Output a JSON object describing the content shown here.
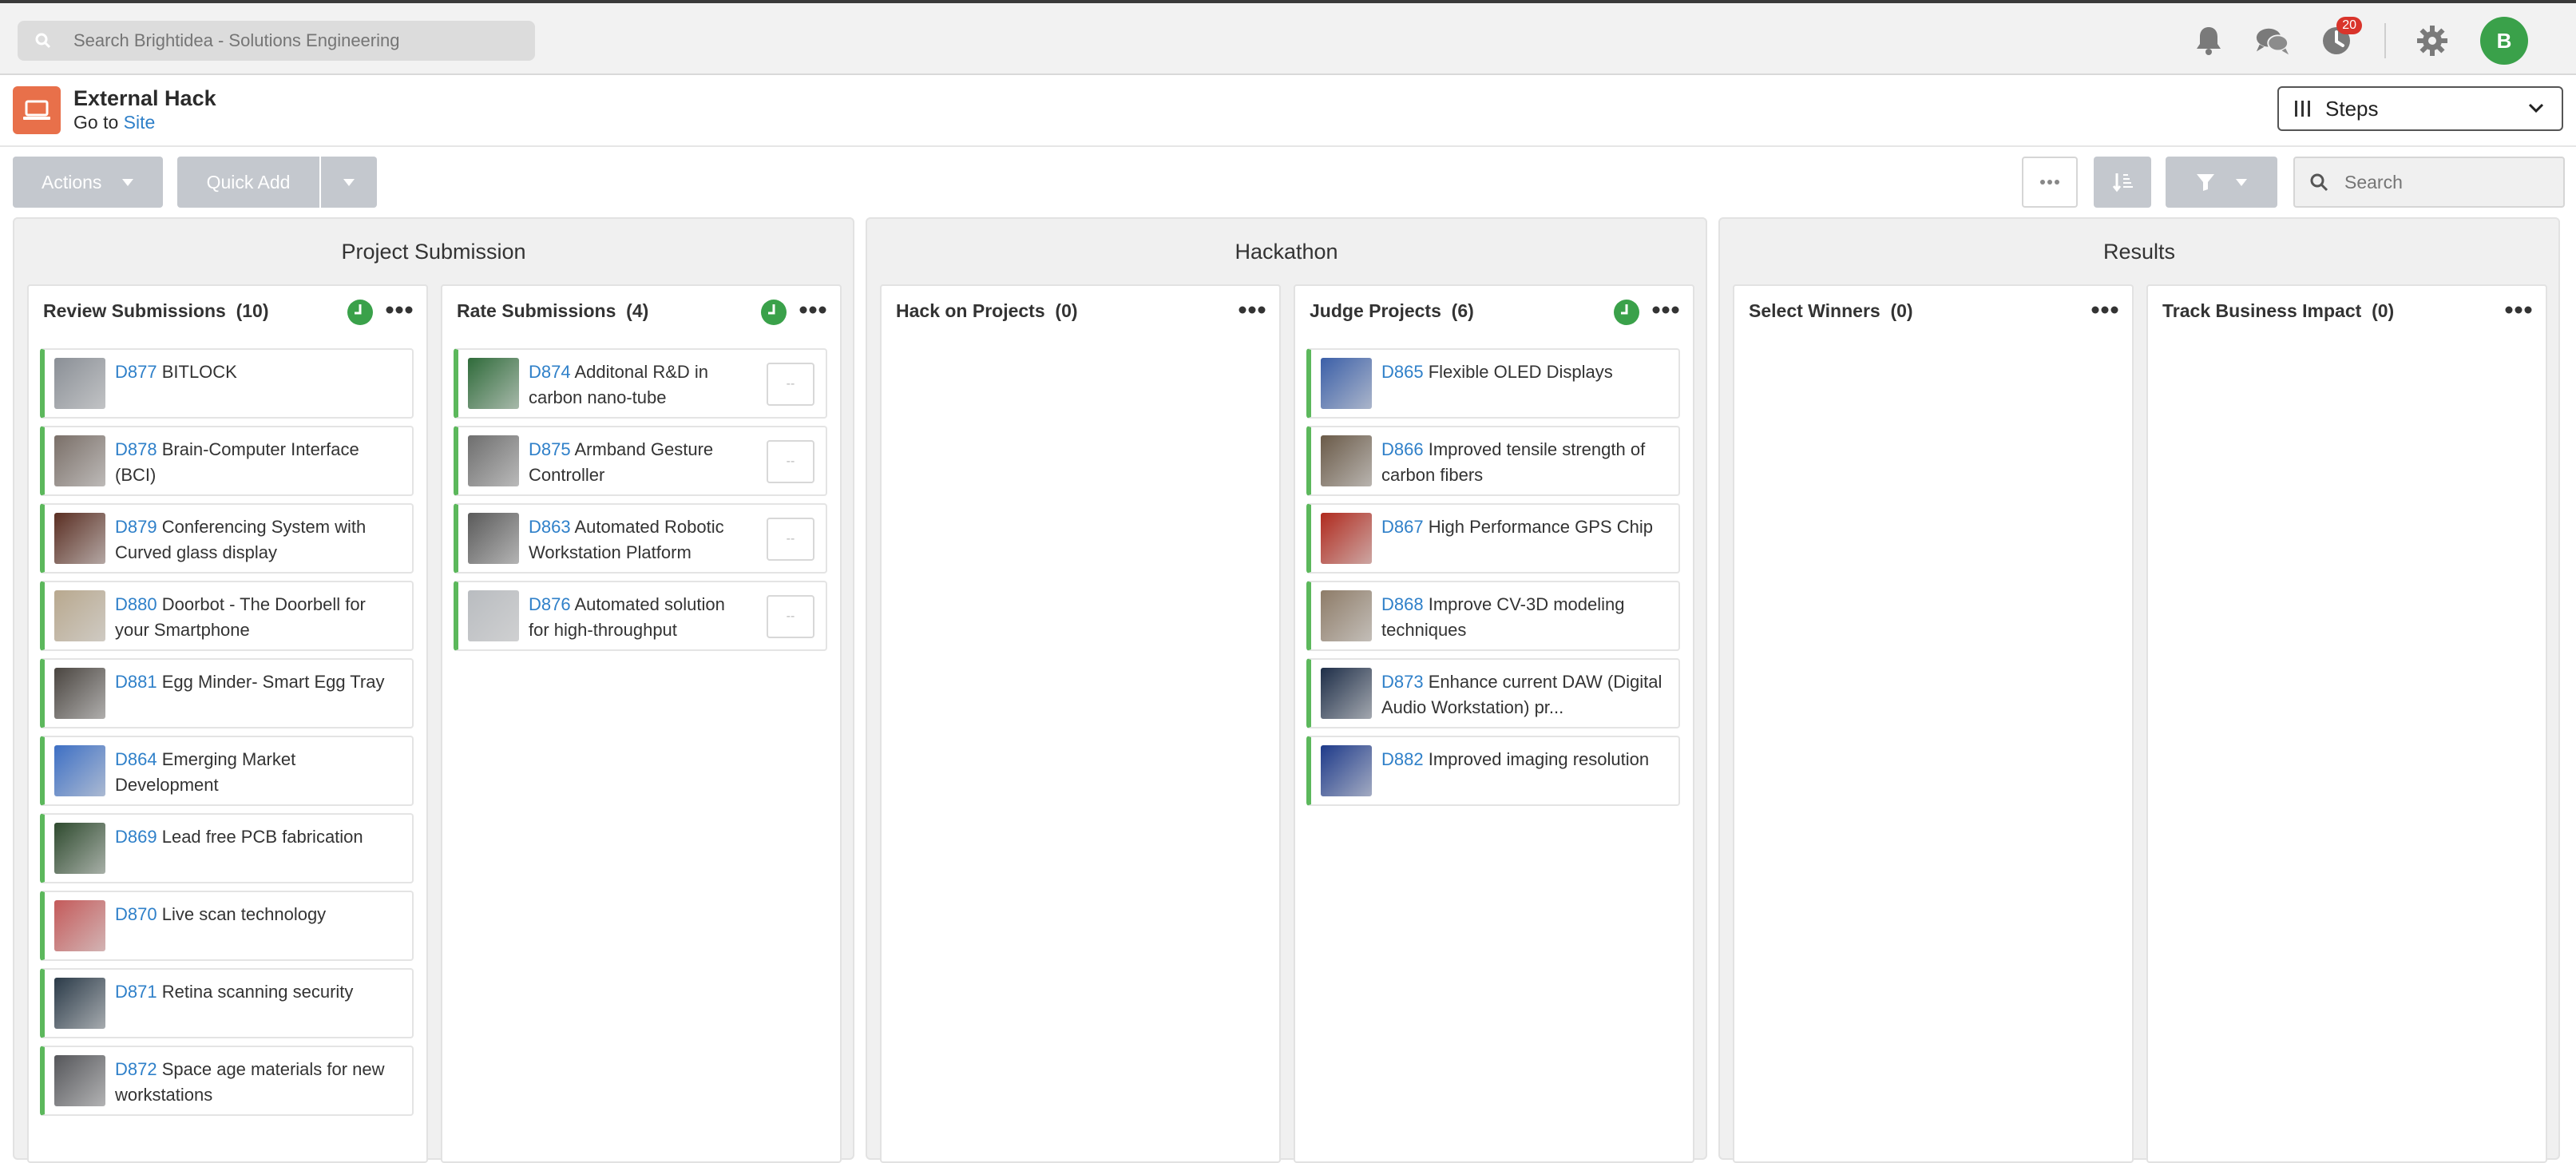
{
  "topbar": {
    "search_placeholder": "Search Brightidea - Solutions Engineering",
    "notifications_badge": "20",
    "avatar_initial": "B"
  },
  "header": {
    "title": "External Hack",
    "goto_prefix": "Go to",
    "goto_link": "Site",
    "view_select": "Steps"
  },
  "toolbar": {
    "actions_label": "Actions",
    "quick_add_label": "Quick Add",
    "search_placeholder": "Search"
  },
  "stages": [
    {
      "title": "Project Submission",
      "columns": [
        {
          "title": "Review Submissions",
          "count": "(10)",
          "cards": [
            {
              "id": "D877",
              "title": "BITLOCK",
              "thumb_color": "#8a8f96"
            },
            {
              "id": "D878",
              "title": "Brain-Computer Interface (BCI)",
              "thumb_color": "#7a6f68"
            },
            {
              "id": "D879",
              "title": "Conferencing System with Curved glass display",
              "thumb_color": "#5a2e22"
            },
            {
              "id": "D880",
              "title": "Doorbot - The Doorbell for your Smartphone",
              "thumb_color": "#b8a88e"
            },
            {
              "id": "D881",
              "title": "Egg Minder- Smart Egg Tray",
              "thumb_color": "#4a4540"
            },
            {
              "id": "D864",
              "title": "Emerging Market Development",
              "thumb_color": "#3d6fc4"
            },
            {
              "id": "D869",
              "title": "Lead free PCB fabrication",
              "thumb_color": "#2e4a2e"
            },
            {
              "id": "D870",
              "title": "Live scan technology",
              "thumb_color": "#c45a5a"
            },
            {
              "id": "D871",
              "title": "Retina scanning security",
              "thumb_color": "#2a3a48"
            },
            {
              "id": "D872",
              "title": "Space age materials for new workstations",
              "thumb_color": "#55565a"
            }
          ]
        },
        {
          "title": "Rate Submissions",
          "count": "(4)",
          "cards": [
            {
              "id": "D874",
              "title": "Additonal R&D in carbon nano-tube",
              "thumb_color": "#2f6b3a",
              "rating": "--"
            },
            {
              "id": "D875",
              "title": "Armband Gesture Controller",
              "thumb_color": "#6e6e6e",
              "rating": "--"
            },
            {
              "id": "D863",
              "title": "Automated Robotic Workstation Platform",
              "thumb_color": "#5a5a5a",
              "rating": "--"
            },
            {
              "id": "D876",
              "title": "Automated solution for high-throughput",
              "thumb_color": "#b9bcc0",
              "rating": "--"
            }
          ]
        }
      ]
    },
    {
      "title": "Hackathon",
      "columns": [
        {
          "title": "Hack on Projects",
          "count": "(0)",
          "cards": []
        },
        {
          "title": "Judge Projects",
          "count": "(6)",
          "cards": [
            {
              "id": "D865",
              "title": "Flexible OLED Displays",
              "thumb_color": "#3b5fa8"
            },
            {
              "id": "D866",
              "title": "Improved tensile strength of carbon fibers",
              "thumb_color": "#6a5a48"
            },
            {
              "id": "D867",
              "title": "High Performance GPS Chip",
              "thumb_color": "#b02a1e"
            },
            {
              "id": "D868",
              "title": "Improve CV-3D modeling techniques",
              "thumb_color": "#8e7c68"
            },
            {
              "id": "D873",
              "title": "Enhance current DAW (Digital Audio Workstation) pr...",
              "thumb_color": "#1e2e48"
            },
            {
              "id": "D882",
              "title": "Improved imaging resolution",
              "thumb_color": "#1e3a8a"
            }
          ]
        }
      ]
    },
    {
      "title": "Results",
      "columns": [
        {
          "title": "Select Winners",
          "count": "(0)",
          "cards": []
        },
        {
          "title": "Track Business Impact",
          "count": "(0)",
          "cards": []
        }
      ]
    }
  ],
  "colors": {
    "accent_green": "#5cb85c",
    "link_blue": "#2f80c9",
    "app_icon_orange": "#e8704a",
    "badge_red": "#d9342b",
    "avatar_green": "#3aa14a"
  }
}
